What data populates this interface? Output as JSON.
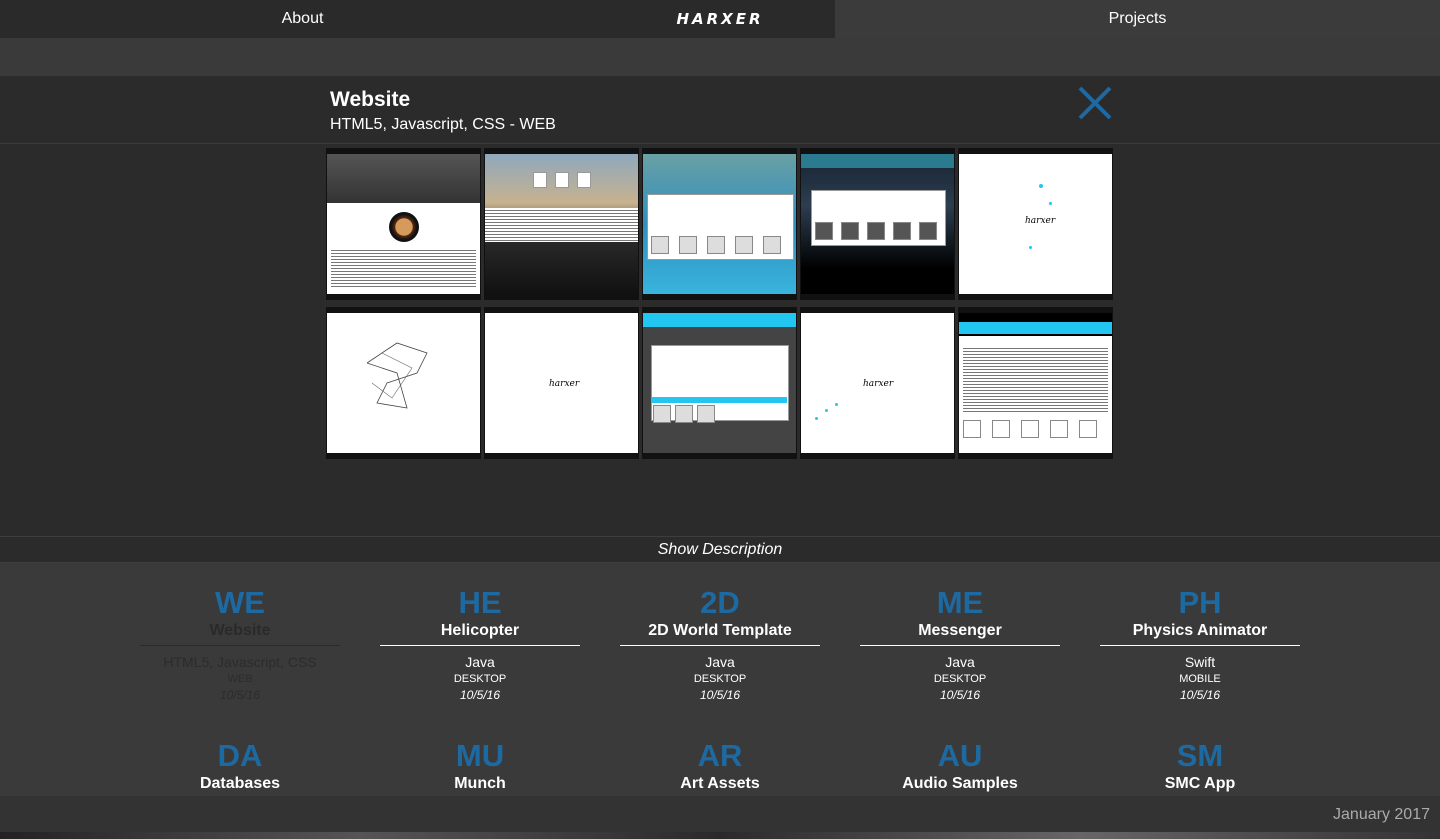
{
  "nav": {
    "about": "About",
    "logo": "HARXER",
    "projects": "Projects"
  },
  "detail": {
    "title": "Website",
    "subtitle": "HTML5, Javascript, CSS - WEB",
    "close_icon": "close-x-icon",
    "accent": "#1d6aa3"
  },
  "show_description": "Show Description",
  "projects": [
    {
      "abbr": "WE",
      "name": "Website",
      "lang": "HTML5, Javascript, CSS",
      "platform": "WEB",
      "date": "10/5/16",
      "active": true
    },
    {
      "abbr": "HE",
      "name": "Helicopter",
      "lang": "Java",
      "platform": "DESKTOP",
      "date": "10/5/16"
    },
    {
      "abbr": "2D",
      "name": "2D World Template",
      "lang": "Java",
      "platform": "DESKTOP",
      "date": "10/5/16"
    },
    {
      "abbr": "ME",
      "name": "Messenger",
      "lang": "Java",
      "platform": "DESKTOP",
      "date": "10/5/16"
    },
    {
      "abbr": "PH",
      "name": "Physics Animator",
      "lang": "Swift",
      "platform": "MOBILE",
      "date": "10/5/16"
    },
    {
      "abbr": "DA",
      "name": "Databases"
    },
    {
      "abbr": "MU",
      "name": "Munch"
    },
    {
      "abbr": "AR",
      "name": "Art Assets"
    },
    {
      "abbr": "AU",
      "name": "Audio Samples"
    },
    {
      "abbr": "SM",
      "name": "SMC App"
    }
  ],
  "footer": {
    "date": "January 2017"
  }
}
